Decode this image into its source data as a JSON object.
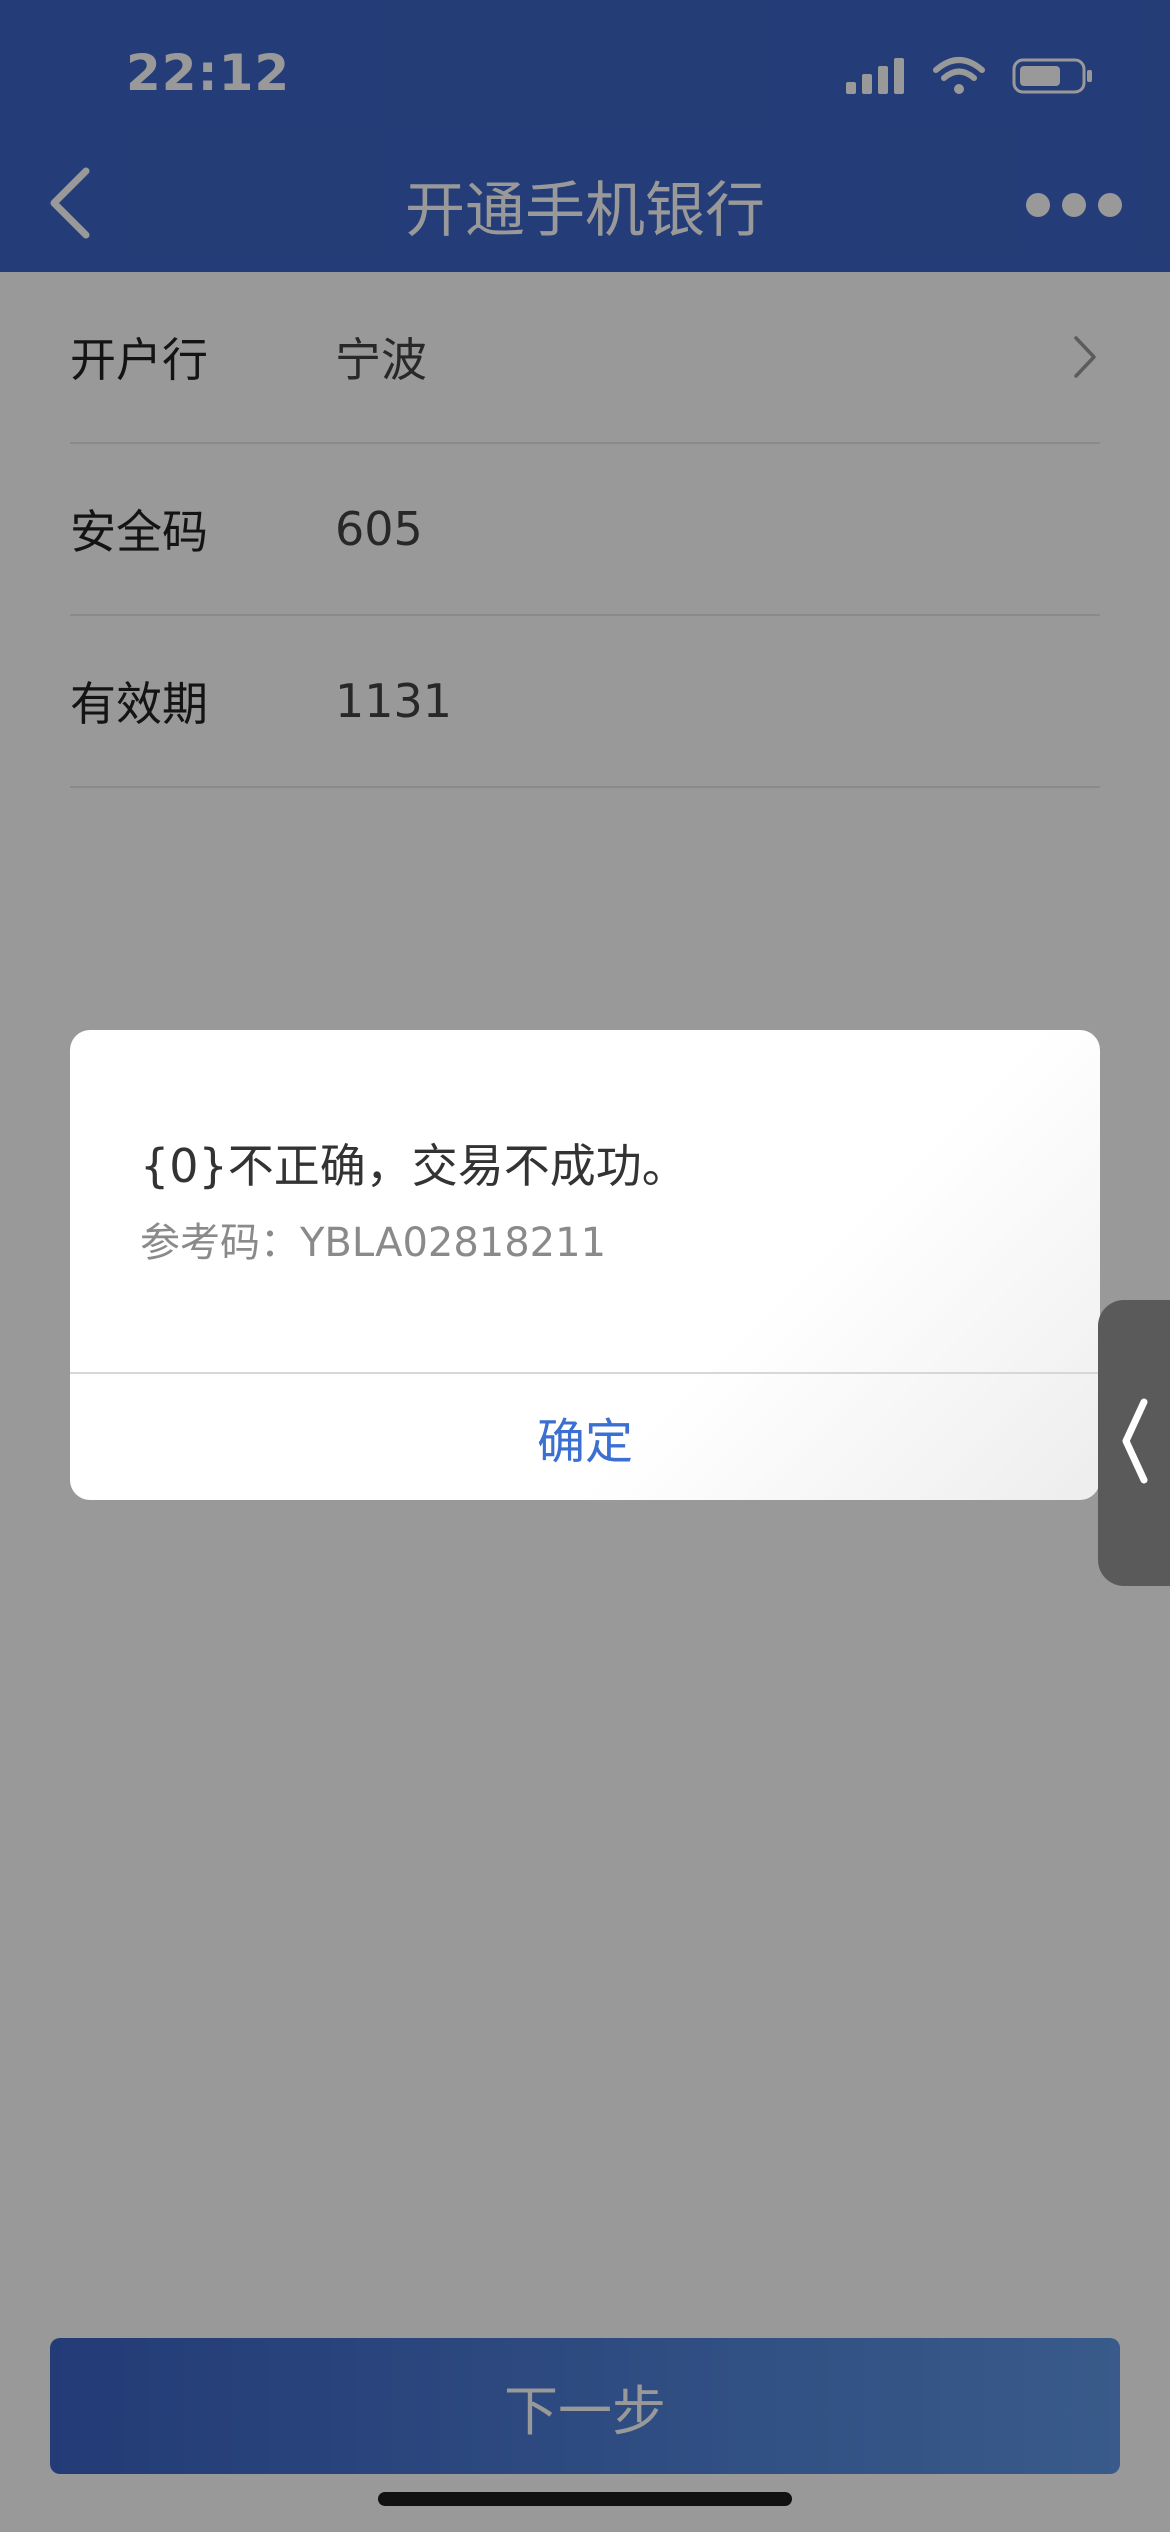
{
  "status_bar": {
    "time": "22:12"
  },
  "nav": {
    "title": "开通手机银行"
  },
  "form": {
    "rows": [
      {
        "label": "开户行",
        "value": "宁波"
      },
      {
        "label": "安全码",
        "value": "605"
      },
      {
        "label": "有效期",
        "value": "1131"
      }
    ]
  },
  "dialog": {
    "message": "{0}不正确，交易不成功。",
    "reference": "参考码：YBLA02818211",
    "confirm_label": "确定"
  },
  "footer": {
    "next_label": "下一步"
  },
  "colors": {
    "header": "#3c65c6",
    "button_start": "#3b64c7",
    "button_end": "#5f97e6",
    "confirm_text": "#3b6fd1"
  },
  "icons": {
    "back": "chevron-left-icon",
    "more": "more-dots-icon",
    "row": "chevron-right-icon",
    "side_tab": "chevron-left-icon",
    "signal": "signal-icon",
    "wifi": "wifi-icon",
    "battery": "battery-icon"
  }
}
